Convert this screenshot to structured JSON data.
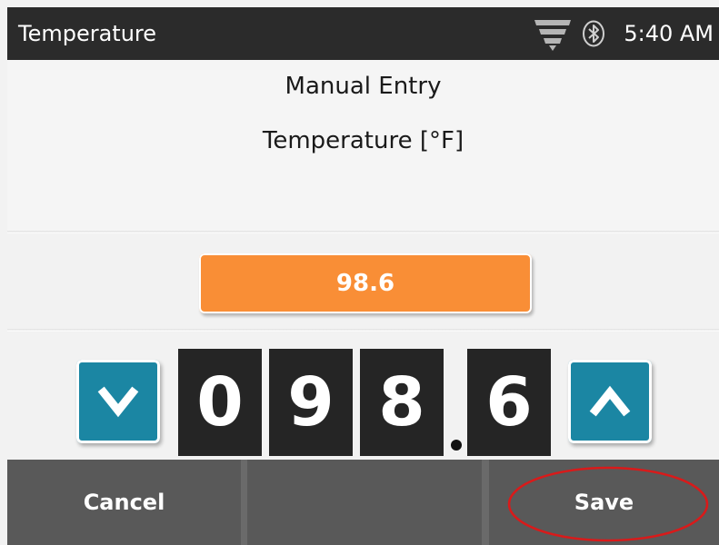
{
  "status_bar": {
    "title": "Temperature",
    "time": "5:40 AM",
    "icons": [
      "signal-icon",
      "bluetooth-icon"
    ]
  },
  "headings": {
    "mode": "Manual Entry",
    "field": "Temperature [°F]"
  },
  "value_display": "98.6",
  "digits": [
    "0",
    "9",
    "8",
    "6"
  ],
  "decimal_symbol": ".",
  "controls": {
    "decrease_icon": "chevron-down-icon",
    "increase_icon": "chevron-up-icon"
  },
  "bottom_bar": {
    "cancel_label": "Cancel",
    "middle_label": "",
    "save_label": "Save"
  },
  "colors": {
    "value_pill": "#f98e36",
    "arrow_button": "#1b86a3",
    "digit_tile": "#252525",
    "status_bar": "#2b2b2b",
    "highlight_ring": "#d91a1a"
  }
}
